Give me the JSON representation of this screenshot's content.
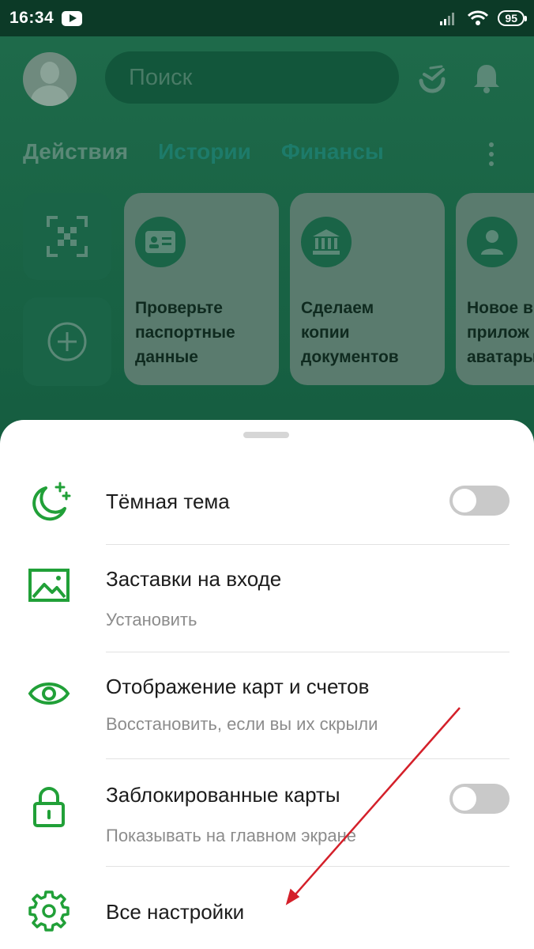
{
  "status_bar": {
    "time": "16:34",
    "battery": "95",
    "icons": [
      "youtube-icon",
      "signal-icon",
      "wifi-icon",
      "battery-icon"
    ]
  },
  "header": {
    "search_placeholder": "Поиск",
    "icons": [
      "avatar",
      "sber-logo-icon",
      "bell-icon"
    ]
  },
  "tabs": [
    {
      "label": "Действия",
      "active": true
    },
    {
      "label": "Истории",
      "active": false
    },
    {
      "label": "Финансы",
      "active": false
    }
  ],
  "side_tiles": [
    {
      "icon": "qr-scan-icon"
    },
    {
      "icon": "plus-circle-icon"
    }
  ],
  "cards": [
    {
      "icon": "id-card-icon",
      "text": "Проверьте\nпаспортные\nданные"
    },
    {
      "icon": "bank-icon",
      "text": "Сделаем\nкопии\nдокументов"
    },
    {
      "icon": "user-icon",
      "text": "Новое в\nприлож\nаватары"
    }
  ],
  "sheet": {
    "items": [
      {
        "icon": "moon-stars-icon",
        "title": "Тёмная тема",
        "subtitle": "",
        "toggle": false
      },
      {
        "icon": "image-icon",
        "title": "Заставки на входе",
        "subtitle": "Установить"
      },
      {
        "icon": "eye-icon",
        "title": "Отображение карт и счетов",
        "subtitle": "Восстановить, если вы их скрыли"
      },
      {
        "icon": "lock-icon",
        "title": "Заблокированные карты",
        "subtitle": "Показывать на главном экране",
        "toggle": false
      },
      {
        "icon": "gear-icon",
        "title": "Все настройки",
        "subtitle": ""
      }
    ]
  },
  "colors": {
    "accent": "#21a038",
    "status_bar": "#0c3a27",
    "annotation_arrow": "#d4202a"
  }
}
